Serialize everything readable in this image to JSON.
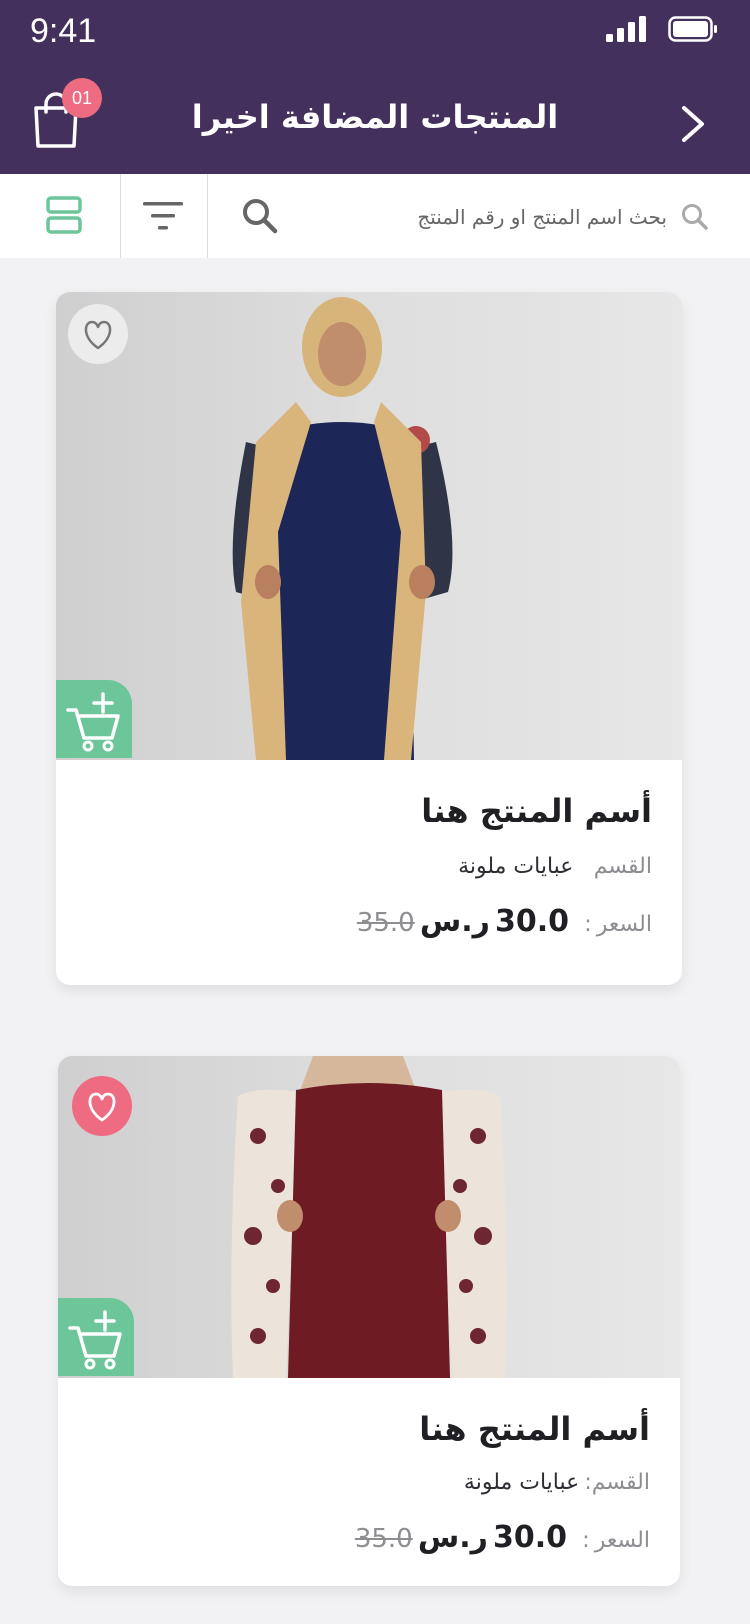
{
  "status_bar": {
    "time": "9:41"
  },
  "header": {
    "title": "المنتجات المضافة اخيرا",
    "cart_count": "01"
  },
  "search": {
    "placeholder": "بحث اسم المنتج او رقم المنتج"
  },
  "colors": {
    "primary": "#44305c",
    "accent_green": "#6dc59a",
    "accent_pink": "#ef6b82"
  },
  "products": [
    {
      "name": "أسم المنتج هنا",
      "category_label": "القسم",
      "category": "عبايات ملونة",
      "price_label": "السعر",
      "price_sep": ":",
      "price": "30.0",
      "currency": "ر.س",
      "old_price": "35.0",
      "favorited": false
    },
    {
      "name": "أسم المنتج هنا",
      "category_label": "القسم:",
      "category": "عبايات ملونة",
      "price_label": "السعر",
      "price_sep": ":",
      "price": "30.0",
      "currency": "ر.س",
      "old_price": "35.0",
      "favorited": true
    }
  ]
}
